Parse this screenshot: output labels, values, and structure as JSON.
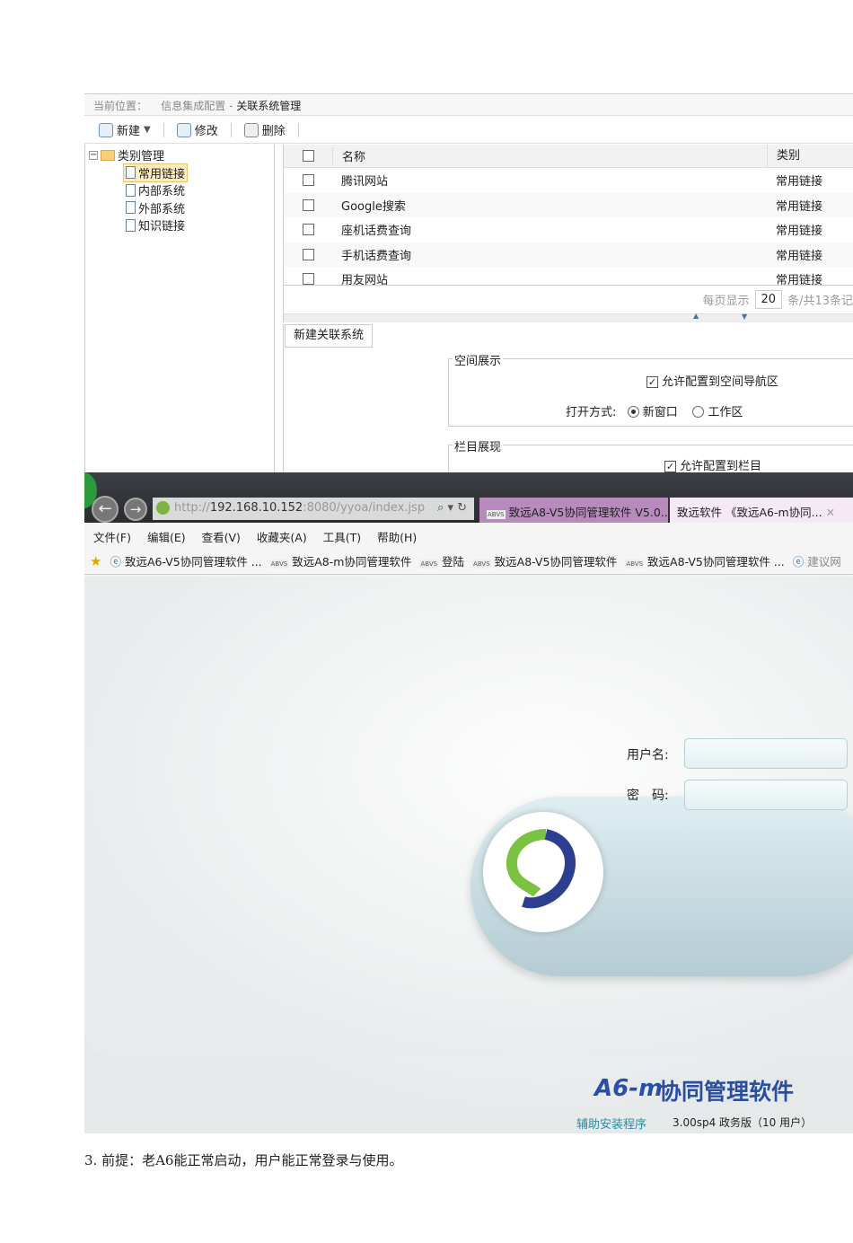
{
  "admin": {
    "breadcrumb": {
      "label": "当前位置：",
      "path1": "信息集成配置",
      "sep": " - ",
      "path2": "关联系统管理"
    },
    "toolbar": {
      "new": "新建",
      "edit": "修改",
      "delete": "删除"
    },
    "tree": {
      "root": "类别管理",
      "items": [
        "常用链接",
        "内部系统",
        "外部系统",
        "知识链接"
      ]
    },
    "grid": {
      "headers": {
        "name": "名称",
        "category": "类别"
      },
      "rows": [
        {
          "name": "腾讯网站",
          "category": "常用链接"
        },
        {
          "name": "Google搜索",
          "category": "常用链接"
        },
        {
          "name": "座机话费查询",
          "category": "常用链接"
        },
        {
          "name": "手机话费查询",
          "category": "常用链接"
        },
        {
          "name": "用友网站",
          "category": "常用链接"
        }
      ]
    },
    "pager": {
      "per_page_label": "每页显示",
      "per_page": "20",
      "total": "条/共13条记"
    },
    "form": {
      "tab": "新建关联系统",
      "space_legend": "空间展示",
      "space_allow": "允许配置到空间导航区",
      "open_label": "打开方式:",
      "open_new": "新窗口",
      "open_work": "工作区",
      "column_legend": "栏目展现",
      "column_allow": "允许配置到栏目"
    }
  },
  "browser": {
    "url_prefix": "http://",
    "url_host": "192.168.10.152",
    "url_rest": ":8080/yyoa/index.jsp",
    "tabs": [
      "致远A8-V5协同管理软件 V5.0...",
      "致远软件 《致远A6-m协同..."
    ],
    "menu": [
      "文件(F)",
      "编辑(E)",
      "查看(V)",
      "收藏夹(A)",
      "工具(T)",
      "帮助(H)"
    ],
    "favorites": [
      "致远A6-V5协同管理软件 ...",
      "致远A8-m协同管理软件",
      "登陆",
      "致远A8-V5协同管理软件",
      "致远A8-V5协同管理软件 ...",
      "建议网"
    ],
    "login": {
      "user_label": "用户名:",
      "pass_label": "密　码:"
    },
    "brand": {
      "logo": "A6-m",
      "title": "协同管理软件",
      "helper": "辅助安装程序",
      "version": "3.00sp4 政务版（10 用户）"
    }
  },
  "caption": "3.  前提：老A6能正常启动，用户能正常登录与使用。"
}
